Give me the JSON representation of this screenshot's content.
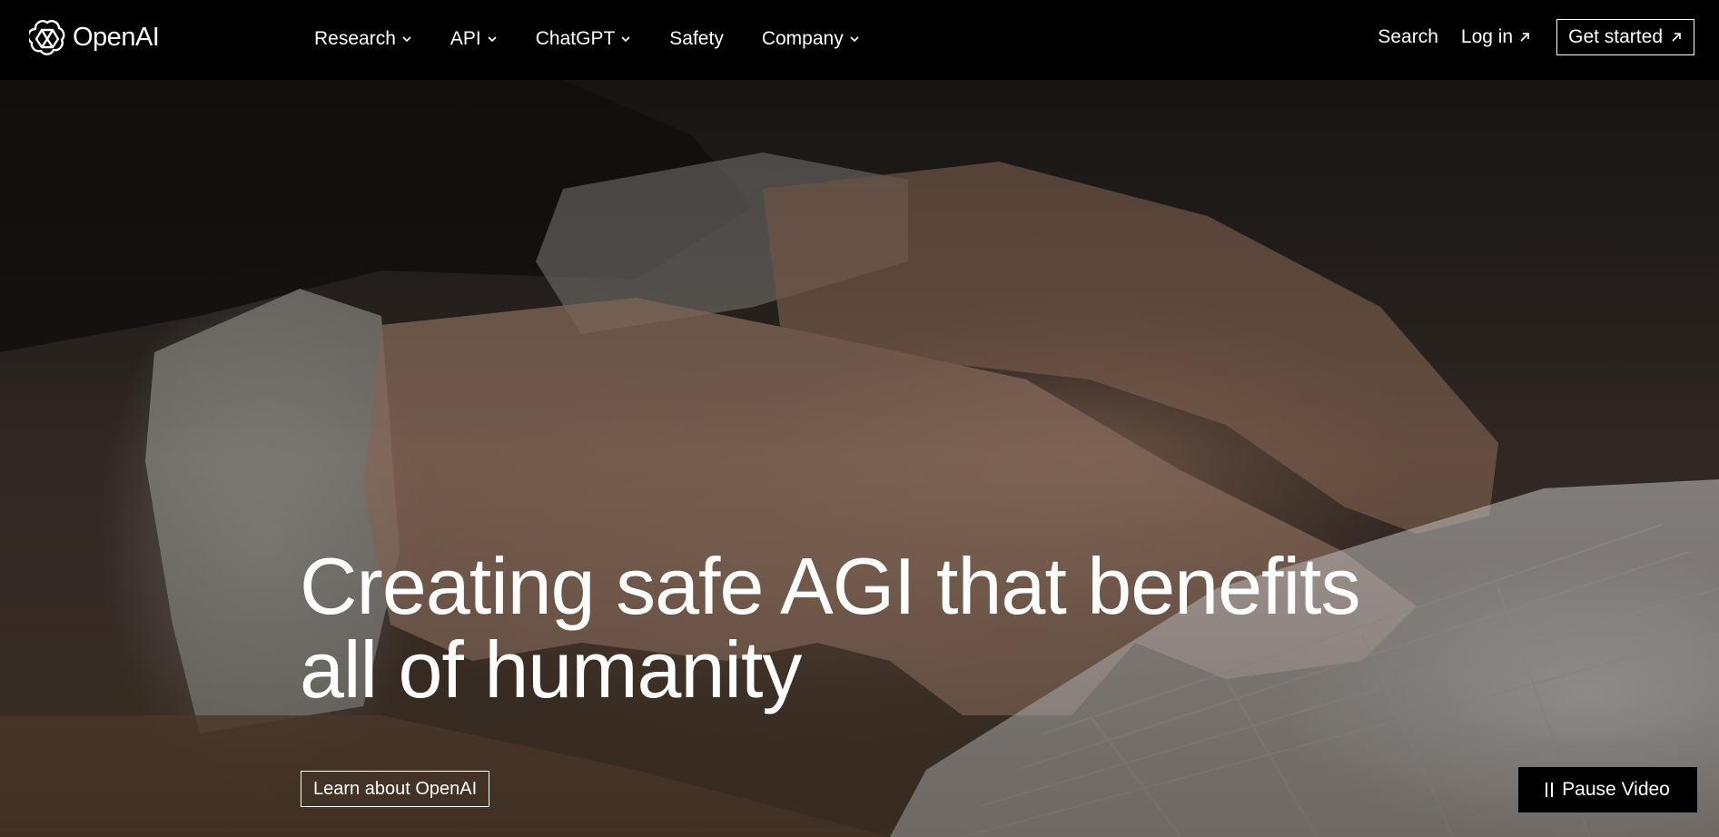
{
  "brand": {
    "name": "OpenAI",
    "logo_icon": "openai-knot-icon"
  },
  "nav": {
    "items": [
      {
        "label": "Research",
        "has_dropdown": true
      },
      {
        "label": "API",
        "has_dropdown": true
      },
      {
        "label": "ChatGPT",
        "has_dropdown": true
      },
      {
        "label": "Safety",
        "has_dropdown": false
      },
      {
        "label": "Company",
        "has_dropdown": true
      }
    ],
    "search_label": "Search",
    "login_label": "Log in",
    "get_started_label": "Get started"
  },
  "hero": {
    "title_line1": "Creating safe AGI that benefits",
    "title_line2": "all of humanity",
    "cta_label": "Learn about OpenAI",
    "pause_label": "Pause Video",
    "background_description_icon": "hands-typing-keyboard-video"
  },
  "colors": {
    "nav_bg": "#000000",
    "text": "#ffffff",
    "pause_bg": "#000000"
  }
}
